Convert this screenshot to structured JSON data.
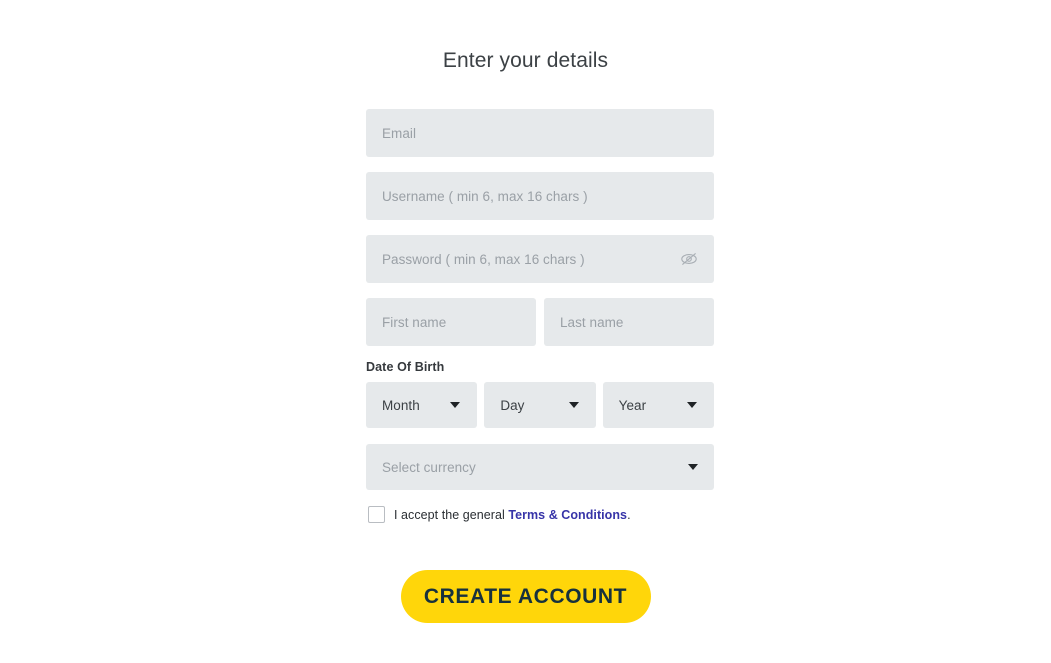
{
  "page": {
    "title": "Enter your details",
    "background": "#ffffff"
  },
  "colors": {
    "field_bg": "#e6e9eb",
    "placeholder": "#9aa0a6",
    "text": "#3c4145",
    "link": "#3734a8",
    "button_bg": "#FFD60A",
    "button_text": "#17313d"
  },
  "form": {
    "email": {
      "placeholder": "Email",
      "value": ""
    },
    "username": {
      "placeholder": "Username ( min 6, max 16 chars )",
      "value": ""
    },
    "password": {
      "placeholder": "Password ( min 6, max 16 chars )",
      "value": "",
      "toggle_icon": "eye-slash-icon"
    },
    "first_name": {
      "placeholder": "First name",
      "value": ""
    },
    "last_name": {
      "placeholder": "Last name",
      "value": ""
    },
    "date_of_birth": {
      "label": "Date Of Birth",
      "month": {
        "selected": "Month",
        "icon": "chevron-down-icon"
      },
      "day": {
        "selected": "Day",
        "icon": "chevron-down-icon"
      },
      "year": {
        "selected": "Year",
        "icon": "chevron-down-icon"
      }
    },
    "currency": {
      "selected": "Select currency",
      "icon": "chevron-down-icon"
    },
    "terms": {
      "checked": false,
      "text": "I accept the general",
      "link_label": "Terms & Conditions",
      "period": "."
    },
    "submit": {
      "label": "CREATE ACCOUNT"
    }
  }
}
